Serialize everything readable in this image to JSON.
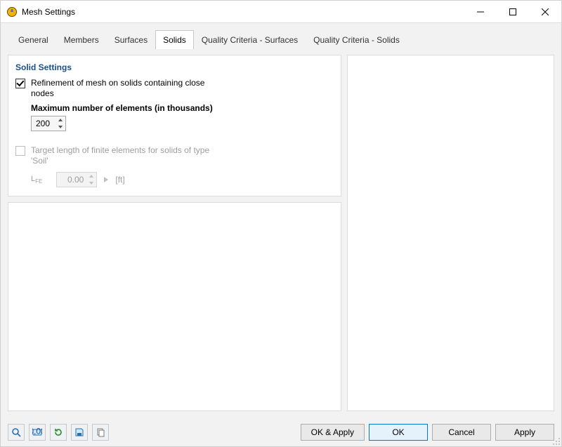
{
  "window": {
    "title": "Mesh Settings"
  },
  "tabs": {
    "items": [
      {
        "label": "General"
      },
      {
        "label": "Members"
      },
      {
        "label": "Surfaces"
      },
      {
        "label": "Solids"
      },
      {
        "label": "Quality Criteria - Surfaces"
      },
      {
        "label": "Quality Criteria - Solids"
      }
    ],
    "active_index": 3
  },
  "solid_settings": {
    "header": "Solid Settings",
    "refinement": {
      "checked": true,
      "label": "Refinement of mesh on solids containing close nodes",
      "max_label": "Maximum number of elements (in thousands)",
      "value": "200"
    },
    "soil": {
      "enabled": false,
      "label": "Target length of finite elements for solids of type 'Soil'",
      "param_symbol": "LFE",
      "value": "0.00",
      "unit": "[ft]"
    }
  },
  "buttons": {
    "ok_apply": "OK & Apply",
    "ok": "OK",
    "cancel": "Cancel",
    "apply": "Apply"
  },
  "toolbar_icons": {
    "i0": "details-icon",
    "i1": "units-icon",
    "i2": "reset-icon",
    "i3": "save-default-icon",
    "i4": "copy-icon"
  }
}
